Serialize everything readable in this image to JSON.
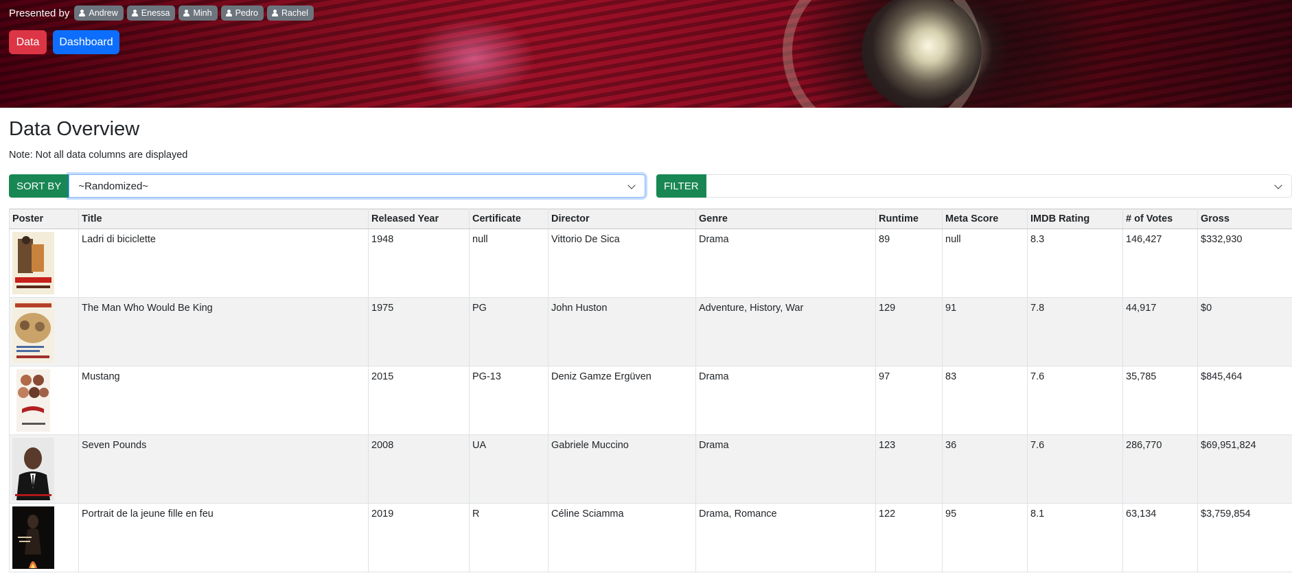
{
  "header": {
    "presented_by": "Presented by",
    "presenters": [
      "Andrew",
      "Enessa",
      "Minh",
      "Pedro",
      "Rachel"
    ],
    "nav": {
      "data_label": "Data",
      "dashboard_label": "Dashboard"
    }
  },
  "overview": {
    "title": "Data Overview",
    "note": "Note: Not all data columns are displayed"
  },
  "controls": {
    "sort_label": "SORT BY",
    "sort_value": "~Randomized~",
    "filter_label": "FILTER",
    "filter_value": ""
  },
  "table": {
    "columns": [
      "Poster",
      "Title",
      "Released Year",
      "Certificate",
      "Director",
      "Genre",
      "Runtime",
      "Meta Score",
      "IMDB Rating",
      "# of Votes",
      "Gross"
    ],
    "rows": [
      {
        "title": "Ladri di biciclette",
        "year": "1948",
        "certificate": "null",
        "director": "Vittorio De Sica",
        "genre": "Drama",
        "runtime": "89",
        "meta": "null",
        "rating": "8.3",
        "votes": "146,427",
        "gross": "$332,930"
      },
      {
        "title": "The Man Who Would Be King",
        "year": "1975",
        "certificate": "PG",
        "director": "John Huston",
        "genre": "Adventure, History, War",
        "runtime": "129",
        "meta": "91",
        "rating": "7.8",
        "votes": "44,917",
        "gross": "$0"
      },
      {
        "title": "Mustang",
        "year": "2015",
        "certificate": "PG-13",
        "director": "Deniz Gamze Ergüven",
        "genre": "Drama",
        "runtime": "97",
        "meta": "83",
        "rating": "7.6",
        "votes": "35,785",
        "gross": "$845,464"
      },
      {
        "title": "Seven Pounds",
        "year": "2008",
        "certificate": "UA",
        "director": "Gabriele Muccino",
        "genre": "Drama",
        "runtime": "123",
        "meta": "36",
        "rating": "7.6",
        "votes": "286,770",
        "gross": "$69,951,824"
      },
      {
        "title": "Portrait de la jeune fille en feu",
        "year": "2019",
        "certificate": "R",
        "director": "Céline Sciamma",
        "genre": "Drama, Romance",
        "runtime": "122",
        "meta": "95",
        "rating": "8.1",
        "votes": "63,134",
        "gross": "$3,759,854"
      }
    ]
  },
  "colors": {
    "data_button": "#dc3545",
    "dashboard_button": "#0d6efd",
    "control_label": "#198754",
    "presenter_badge": "#6c757d"
  }
}
